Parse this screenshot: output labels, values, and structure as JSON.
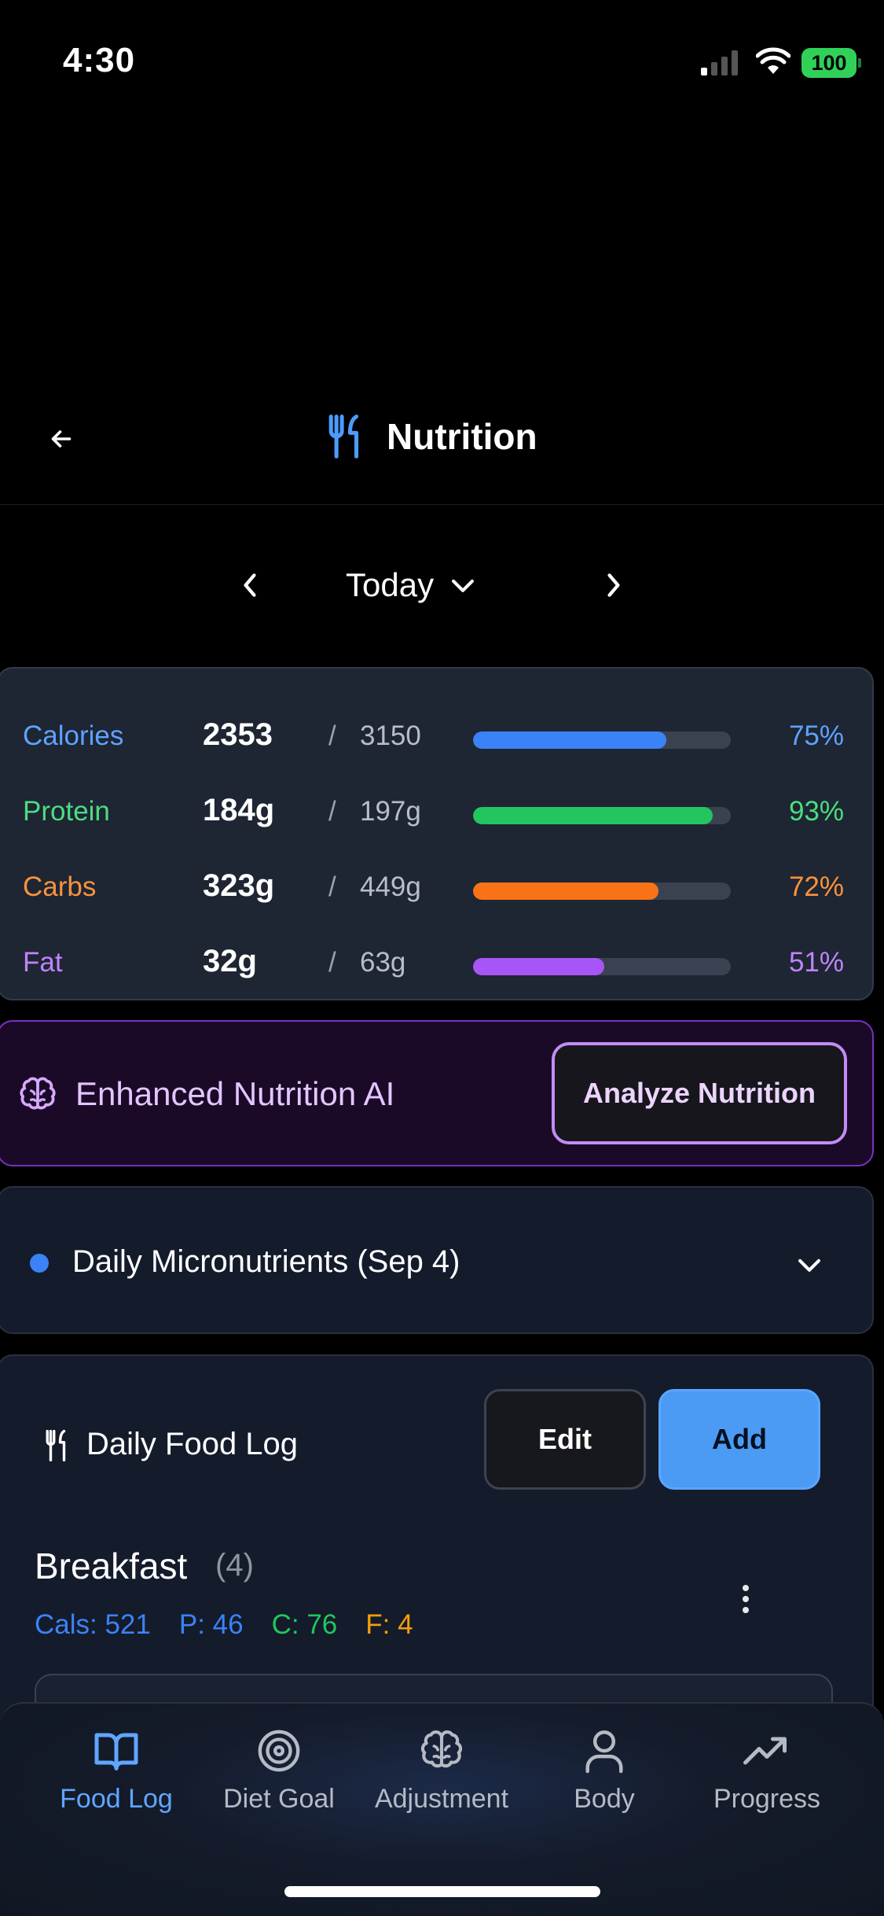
{
  "status_bar": {
    "time": "4:30",
    "battery": "100"
  },
  "header": {
    "title": "Nutrition",
    "back_icon": "arrow-left-icon",
    "title_icon": "utensils-icon",
    "accent": "#4d9bff"
  },
  "date_nav": {
    "label": "Today"
  },
  "macros": [
    {
      "name": "Calories",
      "value": "2353",
      "goal": "3150",
      "percent_label": "75%",
      "progress": 0.75,
      "color": "#5ea2ff",
      "bar_color": "#3b82f6"
    },
    {
      "name": "Protein",
      "value": "184g",
      "goal": "197g",
      "percent_label": "93%",
      "progress": 0.93,
      "color": "#4ade80",
      "bar_color": "#22c55e"
    },
    {
      "name": "Carbs",
      "value": "323g",
      "goal": "449g",
      "percent_label": "72%",
      "progress": 0.72,
      "color": "#fb923c",
      "bar_color": "#f97316"
    },
    {
      "name": "Fat",
      "value": "32g",
      "goal": "63g",
      "percent_label": "51%",
      "progress": 0.51,
      "color": "#c084fc",
      "bar_color": "#a855f7"
    }
  ],
  "ai": {
    "label": "Enhanced Nutrition AI",
    "button": "Analyze Nutrition",
    "icon": "brain-icon"
  },
  "micronutrients": {
    "label": "Daily Micronutrients (Sep 4)"
  },
  "food_log": {
    "title": "Daily Food Log",
    "edit_label": "Edit",
    "add_label": "Add",
    "meal": {
      "name": "Breakfast",
      "count": "(4)",
      "cals": "Cals: 521",
      "protein": "P: 46",
      "carbs": "C: 76",
      "fat": "F: 4"
    }
  },
  "tabs": [
    {
      "label": "Food Log",
      "icon": "book-open-icon",
      "active": true
    },
    {
      "label": "Diet Goal",
      "icon": "target-icon",
      "active": false
    },
    {
      "label": "Adjustment",
      "icon": "brain-icon",
      "active": false
    },
    {
      "label": "Body",
      "icon": "user-icon",
      "active": false
    },
    {
      "label": "Progress",
      "icon": "trending-up-icon",
      "active": false
    }
  ]
}
